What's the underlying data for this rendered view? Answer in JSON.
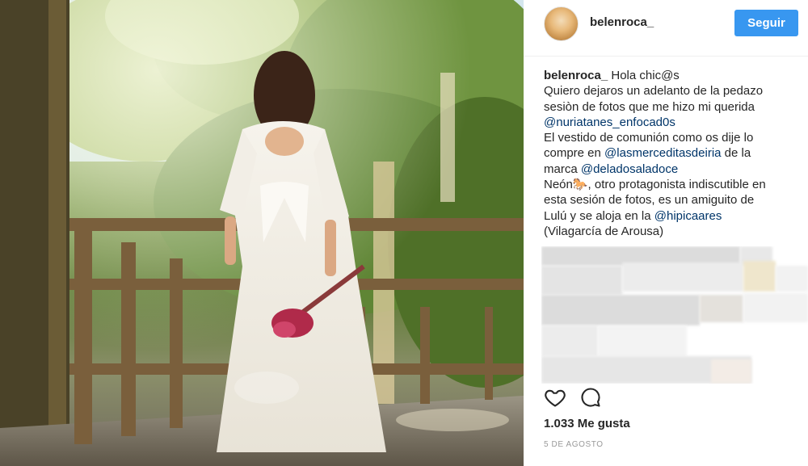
{
  "post": {
    "username": "belenroca_",
    "follow_label": "Seguir",
    "caption_lines": [
      [
        {
          "t": "belenroca_",
          "c": "uname"
        },
        {
          "t": "  Hola chic@s",
          "c": ""
        }
      ],
      [
        {
          "t": "Quiero dejaros un adelanto de la pedazo",
          "c": ""
        }
      ],
      [
        {
          "t": "sesiòn de fotos que me hizo mi querida",
          "c": ""
        }
      ],
      [
        {
          "t": "@nuriatanes_enfocad0s",
          "c": "mention"
        }
      ],
      [
        {
          "t": "El vestido de comunión como os dije lo",
          "c": ""
        }
      ],
      [
        {
          "t": "compre en ",
          "c": ""
        },
        {
          "t": "@lasmerceditasdeiria",
          "c": "mention"
        },
        {
          "t": " de la",
          "c": ""
        }
      ],
      [
        {
          "t": "marca ",
          "c": ""
        },
        {
          "t": "@deladosaladoce",
          "c": "mention"
        }
      ],
      [
        {
          "t": "Neón🐎, otro protagonista indiscutible en",
          "c": ""
        }
      ],
      [
        {
          "t": "esta sesión de fotos, es un amiguito de",
          "c": ""
        }
      ],
      [
        {
          "t": "Lulú y se aloja en la ",
          "c": ""
        },
        {
          "t": "@hipicaares",
          "c": "mention"
        }
      ],
      [
        {
          "t": "(Vilagarcía de Arousa)",
          "c": ""
        }
      ]
    ],
    "likes_count": "1.033",
    "likes_label": "Me gusta",
    "date": "5 DE AGOSTO"
  },
  "icons": {
    "like": "heart-icon",
    "comment": "comment-bubble-icon"
  },
  "colors": {
    "accent": "#3897f0",
    "mention": "#003569",
    "text": "#262626",
    "muted": "#999999"
  }
}
